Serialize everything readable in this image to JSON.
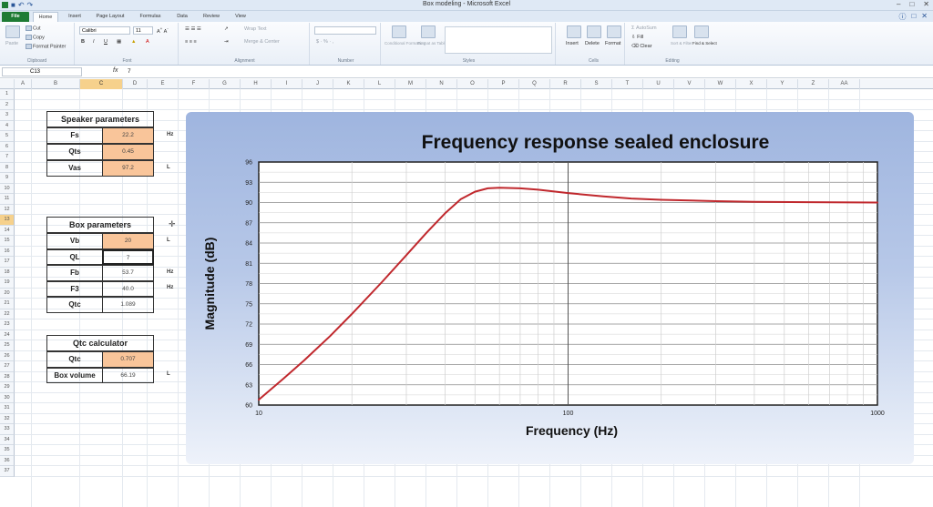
{
  "app": {
    "window_title": "Box modeling - Microsoft Excel"
  },
  "ribbon": {
    "tabs": [
      "File",
      "Home",
      "Insert",
      "Page Layout",
      "Formulas",
      "Data",
      "Review",
      "View"
    ],
    "clipboard": {
      "paste": "Paste",
      "cut": "Cut",
      "copy": "Copy",
      "format_painter": "Format Painter",
      "label": "Clipboard"
    },
    "font": {
      "name": "Calibri",
      "size": "11",
      "bold": "B",
      "italic": "I",
      "underline": "U",
      "label": "Font"
    },
    "alignment": {
      "wrap": "Wrap Text",
      "merge": "Merge & Center",
      "label": "Alignment"
    },
    "number": {
      "label": "Number"
    },
    "styles": {
      "conditional": "Conditional Formatting",
      "format_as_table": "Format as Table",
      "label": "Styles"
    },
    "cells": {
      "insert": "Insert",
      "delete": "Delete",
      "format": "Format",
      "label": "Cells"
    },
    "editing": {
      "autosum": "AutoSum",
      "fill": "Fill",
      "clear": "Clear",
      "sort_filter": "Sort & Filter",
      "find_select": "Find & Select",
      "label": "Editing"
    }
  },
  "formula_bar": {
    "name_box": "C13",
    "fx": "fx",
    "value": "7"
  },
  "columns": [
    "A",
    "B",
    "C",
    "D",
    "E",
    "F",
    "G",
    "H",
    "I",
    "J",
    "K",
    "L",
    "M",
    "N",
    "O",
    "P",
    "Q",
    "R",
    "S",
    "T",
    "U",
    "V",
    "W",
    "X",
    "Y",
    "Z",
    "AA"
  ],
  "rows": [
    "1",
    "2",
    "3",
    "4",
    "5",
    "6",
    "7",
    "8",
    "9",
    "10",
    "11",
    "12",
    "13",
    "14",
    "15",
    "16",
    "17",
    "18",
    "19",
    "20",
    "21",
    "22",
    "23",
    "24",
    "25",
    "26",
    "27",
    "28",
    "29",
    "30",
    "31",
    "32",
    "33",
    "34",
    "35",
    "36",
    "37"
  ],
  "speaker": {
    "title": "Speaker parameters",
    "rows": [
      {
        "label": "Fs",
        "value": "22.2",
        "unit": "Hz"
      },
      {
        "label": "Qts",
        "value": "0.45",
        "unit": ""
      },
      {
        "label": "Vas",
        "value": "97.2",
        "unit": "L"
      }
    ]
  },
  "box": {
    "title": "Box parameters",
    "rows": [
      {
        "label": "Vb",
        "value": "20",
        "unit": "L"
      },
      {
        "label": "QL",
        "value": "7",
        "unit": ""
      },
      {
        "label": "Fb",
        "value": "53.7",
        "unit": "Hz"
      },
      {
        "label": "F3",
        "value": "40.0",
        "unit": "Hz"
      },
      {
        "label": "Qtc",
        "value": "1.089",
        "unit": ""
      }
    ]
  },
  "qtc_calc": {
    "title": "Qtc calculator",
    "rows": [
      {
        "label": "Qtc",
        "value": "0.707",
        "unit": ""
      },
      {
        "label": "Box volume",
        "value": "66.19",
        "unit": "L"
      }
    ]
  },
  "chart_data": {
    "type": "line",
    "title": "Frequency response sealed enclosure",
    "xlabel": "Frequency (Hz)",
    "ylabel": "Magnitude (dB)",
    "xscale": "log",
    "xlim": [
      10,
      1000
    ],
    "ylim": [
      60,
      96
    ],
    "x_ticks": [
      "10",
      "100",
      "1000"
    ],
    "y_ticks": [
      "60",
      "63",
      "66",
      "69",
      "72",
      "75",
      "78",
      "81",
      "84",
      "87",
      "90",
      "93",
      "96"
    ],
    "grid": true,
    "legend": "none",
    "series": [
      {
        "color": "#c0282d",
        "x": [
          10,
          12,
          14,
          17,
          20,
          25,
          30,
          35,
          40,
          45,
          50,
          55,
          60,
          70,
          80,
          100,
          130,
          160,
          200,
          300,
          400,
          600,
          1000
        ],
        "y": [
          60.8,
          63.9,
          66.6,
          70.2,
          73.5,
          78.2,
          82.2,
          85.6,
          88.4,
          90.5,
          91.6,
          92.1,
          92.2,
          92.1,
          91.9,
          91.4,
          90.9,
          90.6,
          90.4,
          90.2,
          90.1,
          90.05,
          90.0
        ]
      }
    ]
  }
}
